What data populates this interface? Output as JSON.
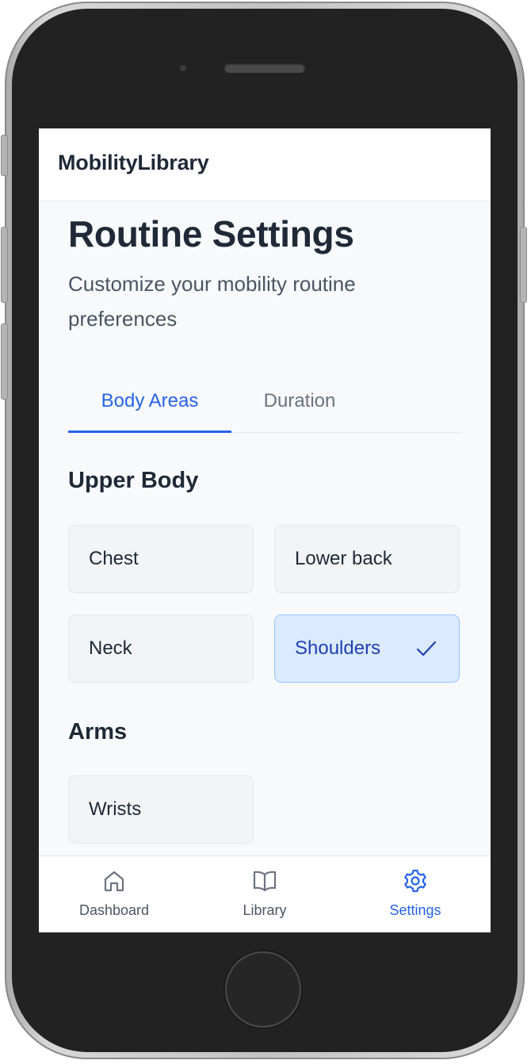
{
  "app": {
    "title": "MobilityLibrary"
  },
  "page": {
    "title": "Routine Settings",
    "subtitle": "Customize your mobility routine preferences"
  },
  "tabs": [
    {
      "label": "Body Areas",
      "active": true
    },
    {
      "label": "Duration",
      "active": false
    }
  ],
  "sections": [
    {
      "heading": "Upper Body",
      "options": [
        {
          "label": "Chest",
          "selected": false
        },
        {
          "label": "Lower back",
          "selected": false
        },
        {
          "label": "Neck",
          "selected": false
        },
        {
          "label": "Shoulders",
          "selected": true
        }
      ]
    },
    {
      "heading": "Arms",
      "options": [
        {
          "label": "Wrists",
          "selected": false
        }
      ]
    }
  ],
  "bottom_nav": [
    {
      "label": "Dashboard",
      "icon": "home-icon",
      "active": false
    },
    {
      "label": "Library",
      "icon": "book-open-icon",
      "active": false
    },
    {
      "label": "Settings",
      "icon": "gear-icon",
      "active": true
    }
  ],
  "colors": {
    "accent": "#2563eb",
    "inactive": "#6b7280",
    "selected_bg": "#dbeafe",
    "selected_border": "#93c5fd",
    "text_dark": "#1f2937"
  }
}
